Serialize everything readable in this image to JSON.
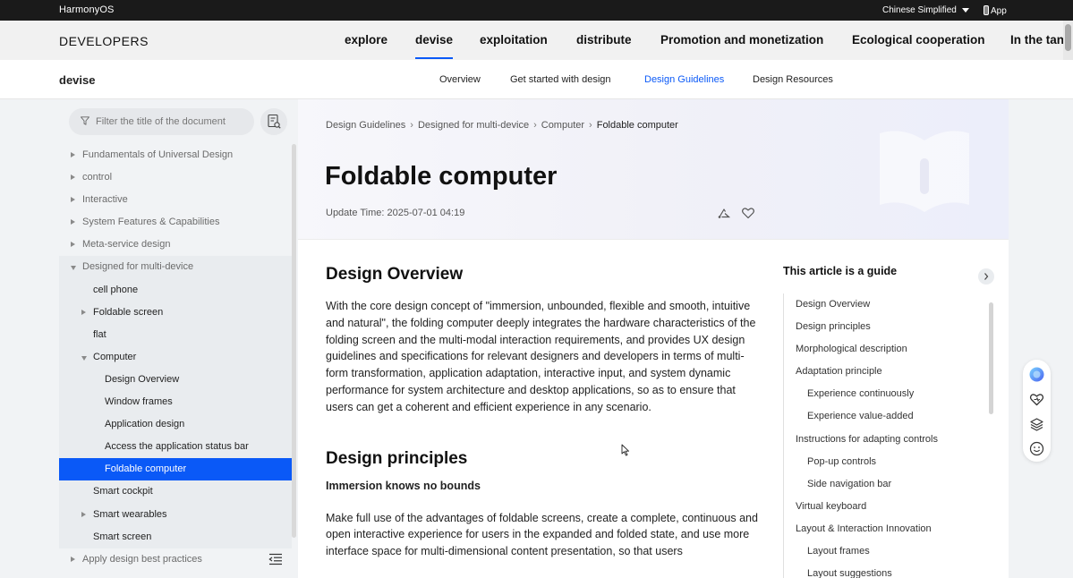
{
  "topbar": {
    "brand": "HarmonyOS",
    "language": "Chinese Simplified",
    "app": "App"
  },
  "mainnav": {
    "logo": "DEVELOPERS",
    "items": [
      "explore",
      "devise",
      "exploitation",
      "distribute",
      "Promotion and monetization",
      "Ecological cooperation",
      "In the tan"
    ],
    "active_index": 1
  },
  "subnav": {
    "title": "devise",
    "links": [
      "Overview",
      "Get started with design",
      "Design Guidelines",
      "Design Resources"
    ],
    "active_index": 2
  },
  "sidebar": {
    "filter_placeholder": "Filter the title of the document",
    "tree": [
      {
        "label": "Fundamentals of Universal Design",
        "level": 0,
        "arrow": "right",
        "grey": true
      },
      {
        "label": "control",
        "level": 0,
        "arrow": "right",
        "grey": true
      },
      {
        "label": "Interactive",
        "level": 0,
        "arrow": "right",
        "grey": true
      },
      {
        "label": "System Features & Capabilities",
        "level": 0,
        "arrow": "right",
        "grey": true
      },
      {
        "label": "Meta-service design",
        "level": 0,
        "arrow": "right",
        "grey": true
      },
      {
        "label": "Designed for multi-device",
        "level": 0,
        "arrow": "down",
        "grey": true
      },
      {
        "label": "cell phone",
        "level": 1,
        "arrow": "none"
      },
      {
        "label": "Foldable screen",
        "level": 1,
        "arrow": "right"
      },
      {
        "label": "flat",
        "level": 1,
        "arrow": "none"
      },
      {
        "label": "Computer",
        "level": 1,
        "arrow": "down"
      },
      {
        "label": "Design Overview",
        "level": 2,
        "arrow": "none"
      },
      {
        "label": "Window frames",
        "level": 2,
        "arrow": "none"
      },
      {
        "label": "Application design",
        "level": 2,
        "arrow": "none"
      },
      {
        "label": "Access the application status bar",
        "level": 2,
        "arrow": "none"
      },
      {
        "label": "Foldable computer",
        "level": 2,
        "arrow": "none",
        "selected": true
      },
      {
        "label": "Smart cockpit",
        "level": 1,
        "arrow": "none"
      },
      {
        "label": "Smart wearables",
        "level": 1,
        "arrow": "right"
      },
      {
        "label": "Smart screen",
        "level": 1,
        "arrow": "none"
      },
      {
        "label": "Apply design best practices",
        "level": 0,
        "arrow": "right",
        "grey": true
      }
    ]
  },
  "breadcrumb": [
    "Design Guidelines",
    "Designed for multi-device",
    "Computer",
    "Foldable computer"
  ],
  "page": {
    "title": "Foldable computer",
    "update_time": "Update Time: 2025-07-01 04:19"
  },
  "article": {
    "h2_overview": "Design Overview",
    "overview_text": "With the core design concept of \"immersion, unbounded, flexible and smooth, intuitive and natural\", the folding computer deeply integrates the hardware characteristics of the folding screen and the multi-modal interaction requirements, and provides UX design guidelines and specifications for relevant designers and developers in terms of multi-form transformation, application adaptation, interactive input, and system dynamic performance for system architecture and desktop applications, so as to ensure that users can get a coherent and efficient experience in any scenario.",
    "h2_principles": "Design principles",
    "h3_immersion": "Immersion knows no bounds",
    "immersion_text": "Make full use of the advantages of foldable screens, create a complete, continuous and open interactive experience for users in the expanded and folded state, and use more interface space for multi-dimensional content presentation, so that users"
  },
  "toc": {
    "title": "This article is a guide",
    "items": [
      {
        "label": "Design Overview",
        "level": 0
      },
      {
        "label": "Design principles",
        "level": 0
      },
      {
        "label": "Morphological description",
        "level": 0
      },
      {
        "label": "Adaptation principle",
        "level": 0
      },
      {
        "label": "Experience continuously",
        "level": 1
      },
      {
        "label": "Experience value-added",
        "level": 1
      },
      {
        "label": "Instructions for adapting controls",
        "level": 0
      },
      {
        "label": "Pop-up controls",
        "level": 1
      },
      {
        "label": "Side navigation bar",
        "level": 1
      },
      {
        "label": "Virtual keyboard",
        "level": 0
      },
      {
        "label": "Layout & Interaction Innovation",
        "level": 0
      },
      {
        "label": "Layout frames",
        "level": 1
      },
      {
        "label": "Layout suggestions",
        "level": 1
      }
    ]
  },
  "colors": {
    "accent": "#0a59f7",
    "topbar": "#1a1a1a"
  },
  "icons": [
    "filter-icon",
    "document-search-icon",
    "share-icon",
    "heart-icon",
    "chevron-right-icon",
    "assistant-orb-icon",
    "feedback-heart-icon",
    "layers-icon",
    "smiley-icon",
    "collapse-sidebar-icon",
    "mouse-cursor-icon"
  ]
}
